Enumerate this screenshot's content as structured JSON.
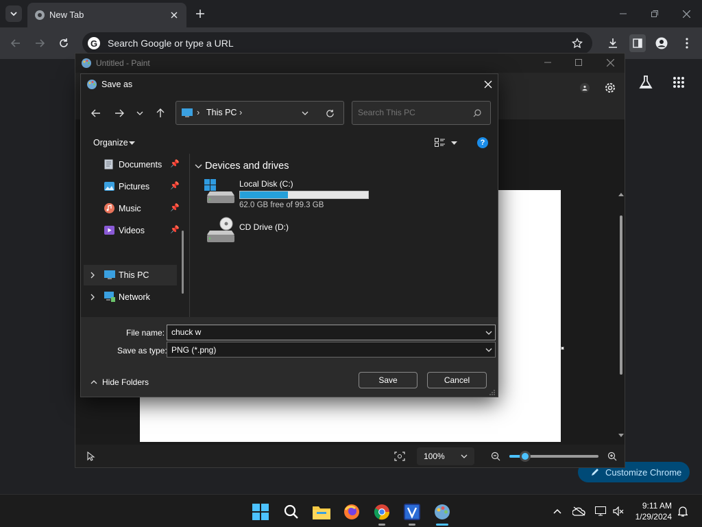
{
  "browser": {
    "tab_title": "New Tab",
    "omnibox_placeholder": "Search Google or type a URL",
    "customize_label": "Customize Chrome"
  },
  "paint": {
    "title": "Untitled - Paint",
    "zoom": "100%",
    "zoom_level_percent": 100
  },
  "dialog": {
    "title": "Save as",
    "breadcrumb": "This PC",
    "search_placeholder": "Search This PC",
    "organize_label": "Organize",
    "nav_items": [
      {
        "label": "Documents"
      },
      {
        "label": "Pictures"
      },
      {
        "label": "Music"
      },
      {
        "label": "Videos"
      },
      {
        "label": "This PC"
      },
      {
        "label": "Network"
      }
    ],
    "section_title": "Devices and drives",
    "drives": [
      {
        "name": "Local Disk (C:)",
        "info": "62.0 GB free of 99.3 GB",
        "used_fraction": 0.376
      },
      {
        "name": "CD Drive (D:)"
      }
    ],
    "file_name_label": "File name:",
    "file_name_value": "chuck w",
    "save_type_label": "Save as type:",
    "save_type_value": "PNG (*.png)",
    "hide_folders_label": "Hide Folders",
    "save_label": "Save",
    "cancel_label": "Cancel"
  },
  "taskbar": {
    "time": "9:11 AM",
    "date": "1/29/2024"
  },
  "colors": {
    "accent": "#4cc2ff",
    "progress_fill": "#26a0da",
    "help": "#1a8ce8"
  }
}
